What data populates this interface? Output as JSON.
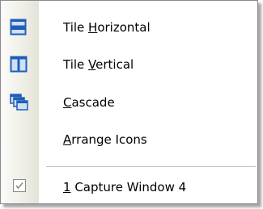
{
  "menu": {
    "items": [
      {
        "pre": "Tile ",
        "mn": "H",
        "post": "orizontal",
        "icon": "tile-horizontal-icon"
      },
      {
        "pre": "Tile ",
        "mn": "V",
        "post": "ertical",
        "icon": "tile-vertical-icon"
      },
      {
        "pre": "",
        "mn": "C",
        "post": "ascade",
        "icon": "cascade-icon"
      },
      {
        "pre": "",
        "mn": "A",
        "post": "rrange Icons",
        "icon": ""
      },
      {
        "pre": "",
        "mn": "1",
        "post": " Capture Window 4",
        "icon": "checkbox-checked-icon"
      }
    ]
  },
  "colors": {
    "icon_blue": "#1f5fb8",
    "icon_light": "#cfe0f7",
    "separator": "#c5c2b2",
    "check": "#8a8a8a"
  }
}
